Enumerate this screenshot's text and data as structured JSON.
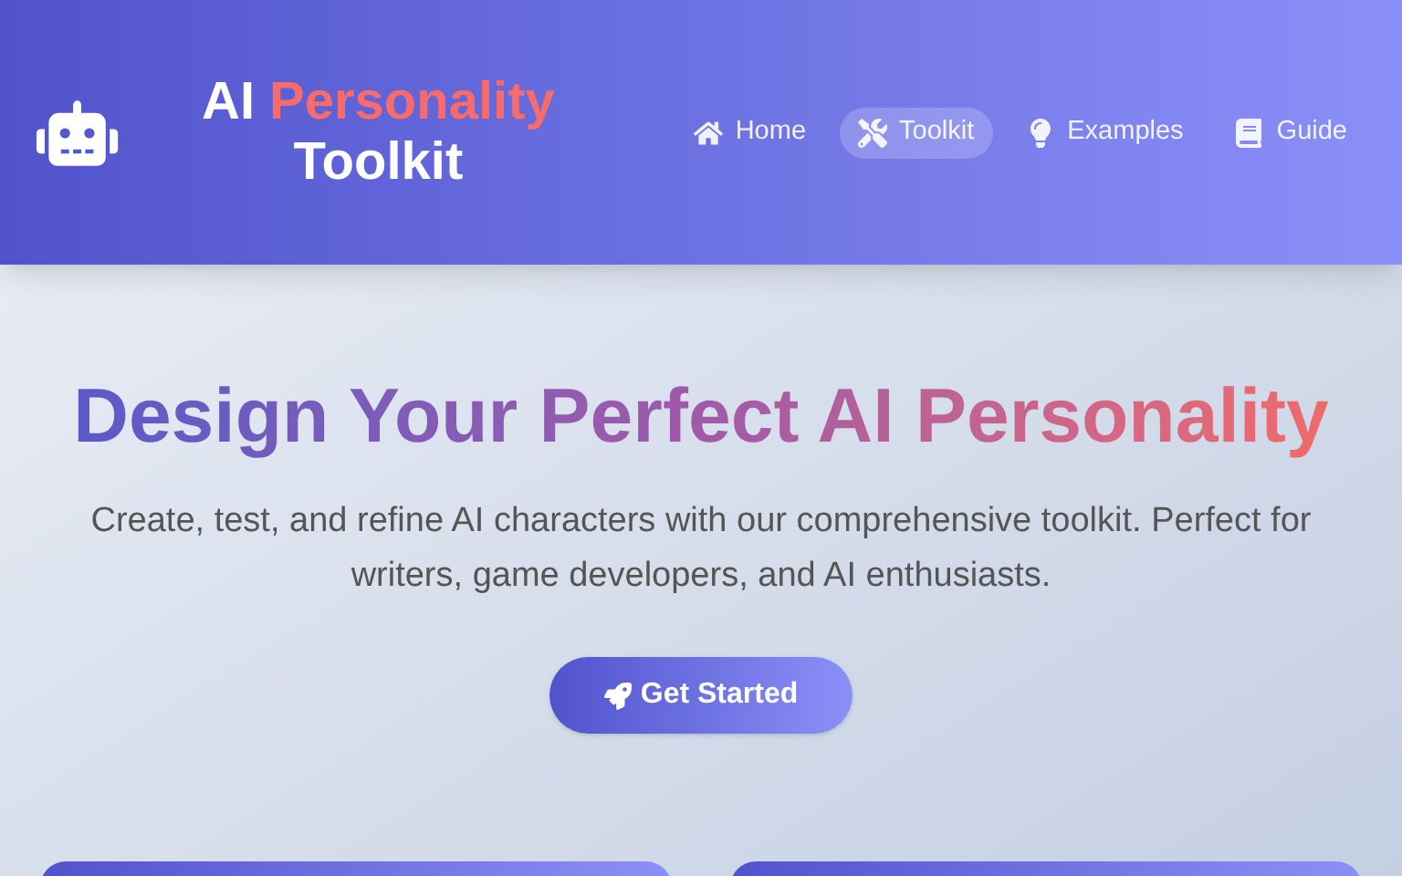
{
  "header": {
    "title": {
      "lead": "AI",
      "accent": "Personality",
      "tail": "Toolkit"
    },
    "nav": [
      {
        "label": "Home",
        "selected": false
      },
      {
        "label": "Toolkit",
        "selected": true
      },
      {
        "label": "Examples",
        "selected": false
      },
      {
        "label": "Guide",
        "selected": false
      }
    ]
  },
  "hero": {
    "heading": "Design Your Perfect AI Personality",
    "subtitle": "Create, test, and refine AI characters with our comprehensive toolkit. Perfect for writers, game developers, and AI enthusiasts.",
    "button": "Get Started"
  }
}
